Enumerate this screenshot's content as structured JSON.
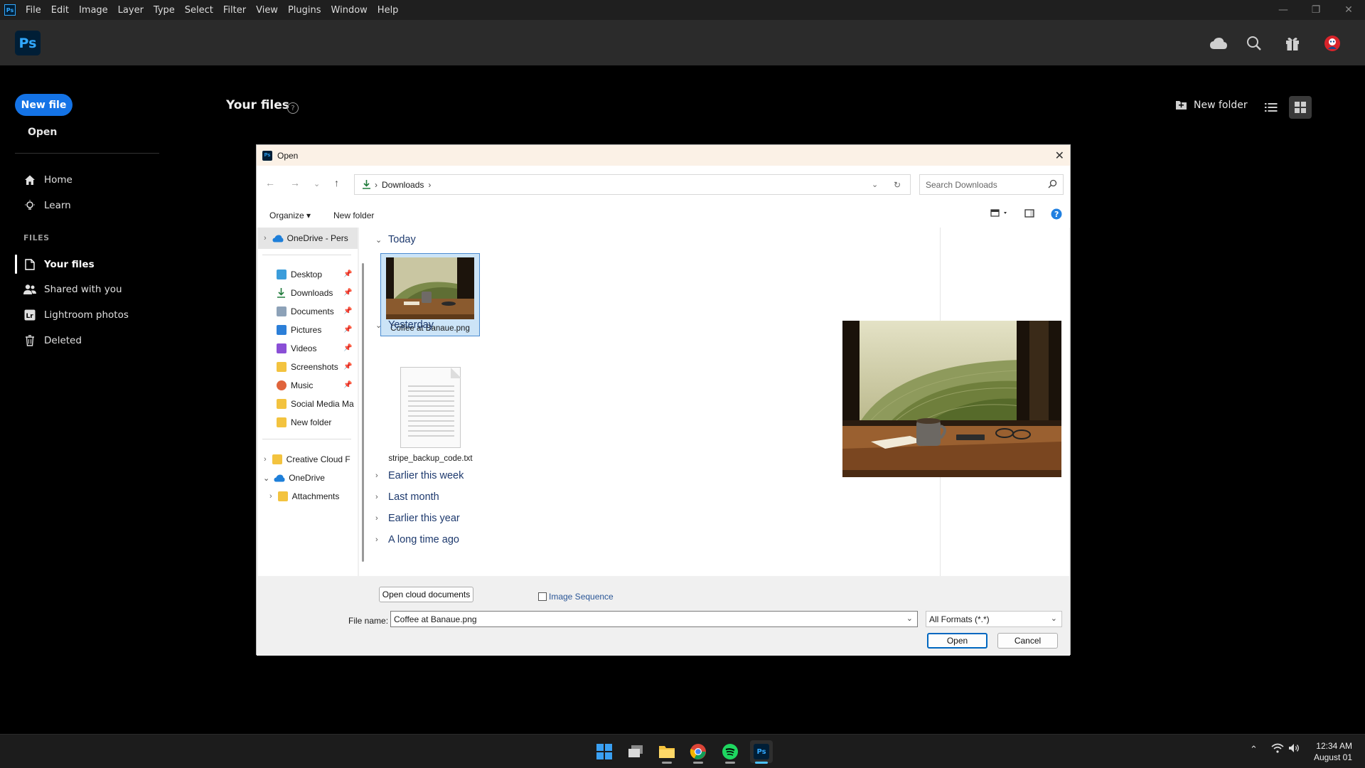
{
  "menubar": {
    "app_icon": "ps-icon",
    "items": [
      "File",
      "Edit",
      "Image",
      "Layer",
      "Type",
      "Select",
      "Filter",
      "View",
      "Plugins",
      "Window",
      "Help"
    ]
  },
  "header": {
    "logo": "Ps"
  },
  "sidebar": {
    "new_file": "New file",
    "open": "Open",
    "nav": [
      {
        "label": "Home",
        "icon": "home-icon"
      },
      {
        "label": "Learn",
        "icon": "lightbulb-icon"
      }
    ],
    "files_heading": "FILES",
    "files": [
      {
        "label": "Your files",
        "icon": "file-icon",
        "active": true
      },
      {
        "label": "Shared with you",
        "icon": "people-icon"
      },
      {
        "label": "Lightroom photos",
        "icon": "lightroom-icon"
      },
      {
        "label": "Deleted",
        "icon": "trash-icon"
      }
    ]
  },
  "main": {
    "title": "Your files",
    "help": "?",
    "new_folder": "New folder"
  },
  "dialog": {
    "title": "Open",
    "address": {
      "folder": "Downloads"
    },
    "search_placeholder": "Search Downloads",
    "toolbar": {
      "organize": "Organize",
      "new_folder": "New folder"
    },
    "nav_pane": [
      {
        "label": "OneDrive - Pers",
        "type": "cloud",
        "expand": true
      },
      {
        "label": "Desktop",
        "type": "desktop",
        "pinned": true
      },
      {
        "label": "Downloads",
        "type": "download",
        "pinned": true
      },
      {
        "label": "Documents",
        "type": "documents",
        "pinned": true
      },
      {
        "label": "Pictures",
        "type": "pictures",
        "pinned": true
      },
      {
        "label": "Videos",
        "type": "videos",
        "pinned": true
      },
      {
        "label": "Screenshots",
        "type": "folder",
        "pinned": true
      },
      {
        "label": "Music",
        "type": "music",
        "pinned": true
      },
      {
        "label": "Social Media Ma",
        "type": "folder"
      },
      {
        "label": "New folder",
        "type": "folder"
      },
      {
        "label": "Creative Cloud F",
        "type": "folder",
        "expand": true
      },
      {
        "label": "OneDrive",
        "type": "cloud",
        "expanded": true
      },
      {
        "label": "Attachments",
        "type": "folder",
        "expand": true
      }
    ],
    "groups": {
      "today": "Today",
      "yesterday": "Yesterday",
      "earlier_week": "Earlier this week",
      "last_month": "Last month",
      "earlier_year": "Earlier this year",
      "long_ago": "A long time ago"
    },
    "files": {
      "image": "Coffee at Banaue.png",
      "text": "stripe_backup_code.txt"
    },
    "bottom": {
      "open_cloud": "Open cloud documents",
      "image_sequence": "Image Sequence",
      "file_name_label": "File name:",
      "file_name_value": "Coffee at Banaue.png",
      "format": "All Formats (*.*)",
      "open": "Open",
      "cancel": "Cancel"
    }
  },
  "taskbar": {
    "apps": [
      "windows-start-icon",
      "task-view-icon",
      "file-explorer-icon",
      "chrome-icon",
      "spotify-icon",
      "photoshop-icon"
    ],
    "ps_label": "Ps",
    "time": "12:34 AM",
    "date": "August 01"
  },
  "colors": {
    "accent": "#1473e6",
    "ps_blue": "#31a8ff",
    "ps_dark": "#001e36"
  }
}
